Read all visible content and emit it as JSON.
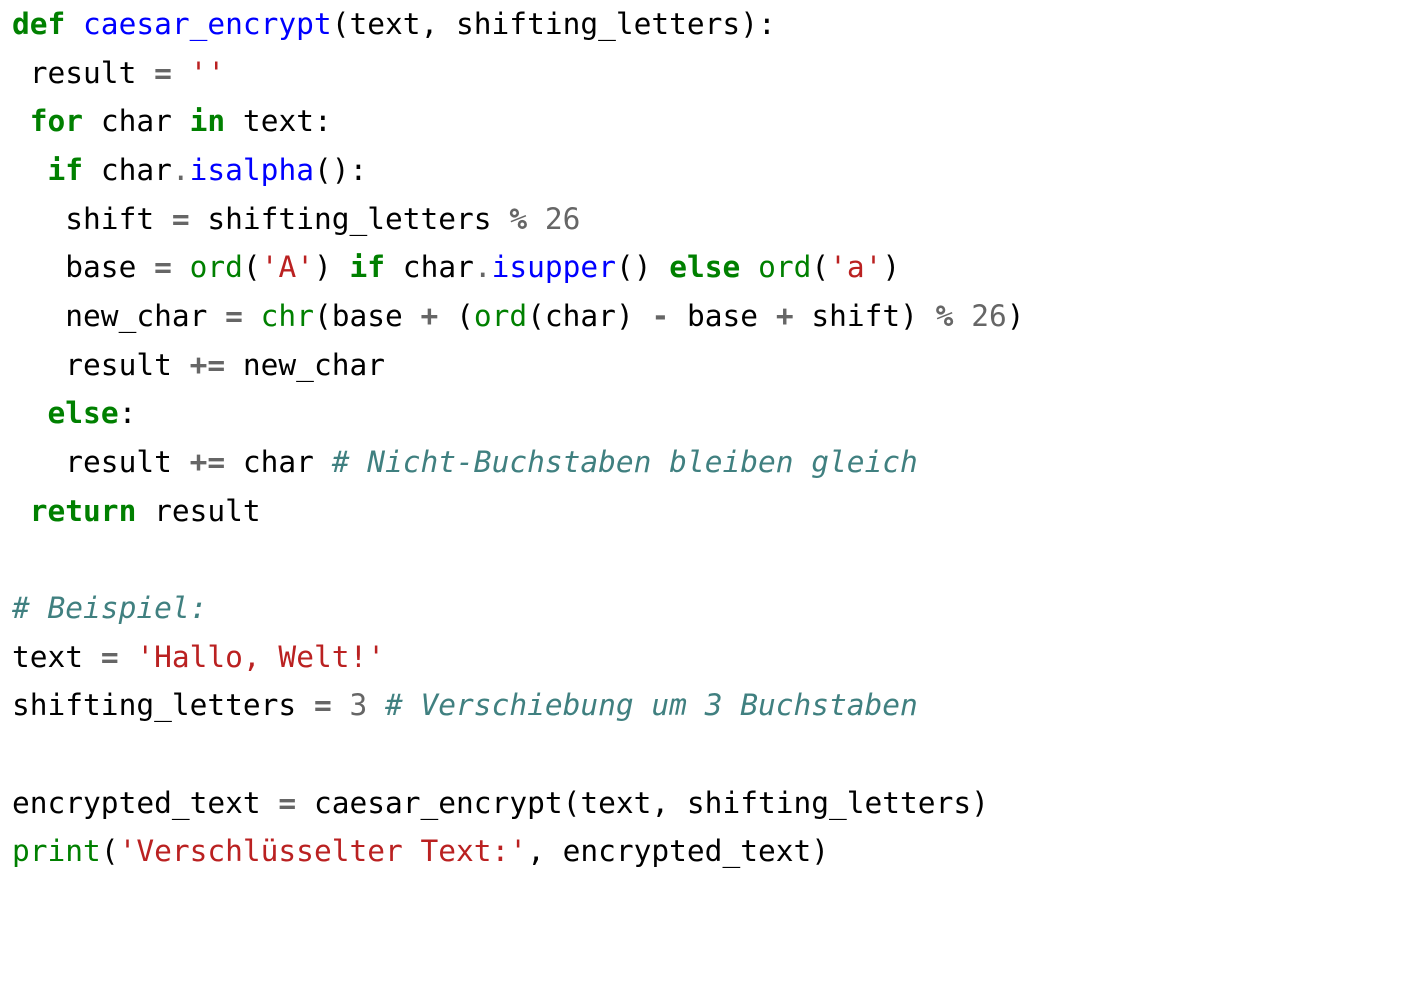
{
  "code": {
    "tokens": [
      [
        {
          "t": "def ",
          "c": "kw"
        },
        {
          "t": "caesar_encrypt",
          "c": "fn"
        },
        {
          "t": "(text, shifting_letters):",
          "c": ""
        }
      ],
      [
        {
          "t": " result ",
          "c": ""
        },
        {
          "t": "=",
          "c": "opb"
        },
        {
          "t": " ",
          "c": ""
        },
        {
          "t": "''",
          "c": "str"
        }
      ],
      [
        {
          "t": " ",
          "c": ""
        },
        {
          "t": "for",
          "c": "kw"
        },
        {
          "t": " char ",
          "c": ""
        },
        {
          "t": "in",
          "c": "kw"
        },
        {
          "t": " text:",
          "c": ""
        }
      ],
      [
        {
          "t": "  ",
          "c": ""
        },
        {
          "t": "if",
          "c": "kw"
        },
        {
          "t": " char",
          "c": ""
        },
        {
          "t": ".",
          "c": "op"
        },
        {
          "t": "isalpha",
          "c": "fn"
        },
        {
          "t": "():",
          "c": ""
        }
      ],
      [
        {
          "t": "   shift ",
          "c": ""
        },
        {
          "t": "=",
          "c": "opb"
        },
        {
          "t": " shifting_letters ",
          "c": ""
        },
        {
          "t": "%",
          "c": "opb"
        },
        {
          "t": " ",
          "c": ""
        },
        {
          "t": "26",
          "c": "num"
        }
      ],
      [
        {
          "t": "   base ",
          "c": ""
        },
        {
          "t": "=",
          "c": "opb"
        },
        {
          "t": " ",
          "c": ""
        },
        {
          "t": "ord",
          "c": "bi"
        },
        {
          "t": "(",
          "c": ""
        },
        {
          "t": "'A'",
          "c": "str"
        },
        {
          "t": ") ",
          "c": ""
        },
        {
          "t": "if",
          "c": "kw"
        },
        {
          "t": " char",
          "c": ""
        },
        {
          "t": ".",
          "c": "op"
        },
        {
          "t": "isupper",
          "c": "fn"
        },
        {
          "t": "() ",
          "c": ""
        },
        {
          "t": "else",
          "c": "kw"
        },
        {
          "t": " ",
          "c": ""
        },
        {
          "t": "ord",
          "c": "bi"
        },
        {
          "t": "(",
          "c": ""
        },
        {
          "t": "'a'",
          "c": "str"
        },
        {
          "t": ")",
          "c": ""
        }
      ],
      [
        {
          "t": "   new_char ",
          "c": ""
        },
        {
          "t": "=",
          "c": "opb"
        },
        {
          "t": " ",
          "c": ""
        },
        {
          "t": "chr",
          "c": "bi"
        },
        {
          "t": "(base ",
          "c": ""
        },
        {
          "t": "+",
          "c": "opb"
        },
        {
          "t": " (",
          "c": ""
        },
        {
          "t": "ord",
          "c": "bi"
        },
        {
          "t": "(char) ",
          "c": ""
        },
        {
          "t": "-",
          "c": "opb"
        },
        {
          "t": " base ",
          "c": ""
        },
        {
          "t": "+",
          "c": "opb"
        },
        {
          "t": " shift) ",
          "c": ""
        },
        {
          "t": "%",
          "c": "opb"
        },
        {
          "t": " ",
          "c": ""
        },
        {
          "t": "26",
          "c": "num"
        },
        {
          "t": ")",
          "c": ""
        }
      ],
      [
        {
          "t": "   result ",
          "c": ""
        },
        {
          "t": "+=",
          "c": "opb"
        },
        {
          "t": " new_char",
          "c": ""
        }
      ],
      [
        {
          "t": "  ",
          "c": ""
        },
        {
          "t": "else",
          "c": "kw"
        },
        {
          "t": ":",
          "c": ""
        }
      ],
      [
        {
          "t": "   result ",
          "c": ""
        },
        {
          "t": "+=",
          "c": "opb"
        },
        {
          "t": " char ",
          "c": ""
        },
        {
          "t": "# Nicht-Buchstaben bleiben gleich",
          "c": "cm"
        }
      ],
      [
        {
          "t": " ",
          "c": ""
        },
        {
          "t": "return",
          "c": "kw"
        },
        {
          "t": " result",
          "c": ""
        }
      ],
      [
        {
          "t": "",
          "c": ""
        }
      ],
      [
        {
          "t": "# Beispiel:",
          "c": "cm"
        }
      ],
      [
        {
          "t": "text ",
          "c": ""
        },
        {
          "t": "=",
          "c": "opb"
        },
        {
          "t": " ",
          "c": ""
        },
        {
          "t": "'Hallo, Welt!'",
          "c": "str"
        }
      ],
      [
        {
          "t": "shifting_letters ",
          "c": ""
        },
        {
          "t": "=",
          "c": "opb"
        },
        {
          "t": " ",
          "c": ""
        },
        {
          "t": "3",
          "c": "num"
        },
        {
          "t": " ",
          "c": ""
        },
        {
          "t": "# Verschiebung um 3 Buchstaben",
          "c": "cm"
        }
      ],
      [
        {
          "t": "",
          "c": ""
        }
      ],
      [
        {
          "t": "encrypted_text ",
          "c": ""
        },
        {
          "t": "=",
          "c": "opb"
        },
        {
          "t": " caesar_encrypt(text, shifting_letters)",
          "c": ""
        }
      ],
      [
        {
          "t": "print",
          "c": "bi"
        },
        {
          "t": "(",
          "c": ""
        },
        {
          "t": "'Verschlüsselter Text:'",
          "c": "str"
        },
        {
          "t": ", encrypted_text)",
          "c": ""
        }
      ]
    ]
  }
}
